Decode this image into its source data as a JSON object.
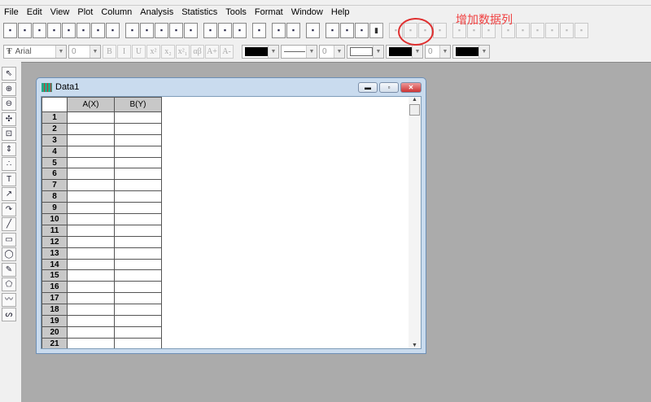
{
  "menu": [
    "File",
    "Edit",
    "View",
    "Plot",
    "Column",
    "Analysis",
    "Statistics",
    "Tools",
    "Format",
    "Window",
    "Help"
  ],
  "toolbar1": {
    "icons": [
      "new-project-icon",
      "new-worksheet-icon",
      "new-excel-icon",
      "new-graph-icon",
      "new-matrix-icon",
      "new-function-icon",
      "new-layout-icon",
      "new-notes-icon",
      "open-icon",
      "open-template-icon",
      "open-excel-icon",
      "save-project-icon",
      "save-template-icon",
      "import-ascii-icon",
      "import-multiple-icon",
      "import-wizard-icon",
      "print-icon",
      "duplicate-icon",
      "refresh-icon",
      "project-explorer-icon",
      "results-log-icon",
      "script-window-icon",
      "code-builder-icon",
      "add-new-column-icon",
      "zoom-in-icon",
      "zoom-out-icon",
      "whole-page-icon",
      "rescale-icon",
      "layer-1-icon",
      "layer-2-icon",
      "layer-4-icon",
      "axis-l-icon",
      "axis-box-icon",
      "axis-u-icon",
      "axis-full-icon",
      "axis-break-icon",
      "axis-break2-icon"
    ]
  },
  "toolbar2": {
    "font": "Arial",
    "font_size": "0",
    "buttons": [
      "B",
      "I",
      "U",
      "x²",
      "x₂",
      "x²₁",
      "αβ",
      "A+",
      "A-"
    ],
    "line_width": "0",
    "pattern_size": "0"
  },
  "left_tools": [
    "pointer-icon",
    "zoom-in-icon",
    "zoom-out-icon",
    "screen-reader-icon",
    "data-selector-icon",
    "data-reader-icon",
    "draw-data-icon",
    "text-tool-icon",
    "arrow-tool-icon",
    "curved-arrow-icon",
    "line-tool-icon",
    "rectangle-tool-icon",
    "circle-tool-icon",
    "polyline-tool-icon",
    "region-tool-icon",
    "freehand-tool-icon",
    "curve-tool-icon"
  ],
  "left_glyphs": [
    "⇖",
    "⊕",
    "⊖",
    "✣",
    "⊡",
    "⇕",
    "∴",
    "T",
    "↗",
    "↷",
    "╱",
    "▭",
    "◯",
    "✎",
    "⬠",
    "〰",
    "ᔕ"
  ],
  "window": {
    "title": "Data1",
    "columns": [
      "",
      "A(X)",
      "B(Y)"
    ],
    "rows": [
      "1",
      "2",
      "3",
      "4",
      "5",
      "6",
      "7",
      "8",
      "9",
      "10",
      "11",
      "12",
      "13",
      "14",
      "15",
      "16",
      "17",
      "18",
      "19",
      "20",
      "21"
    ]
  },
  "annotation": {
    "text": "增加数据列",
    "color": "#e03030"
  }
}
